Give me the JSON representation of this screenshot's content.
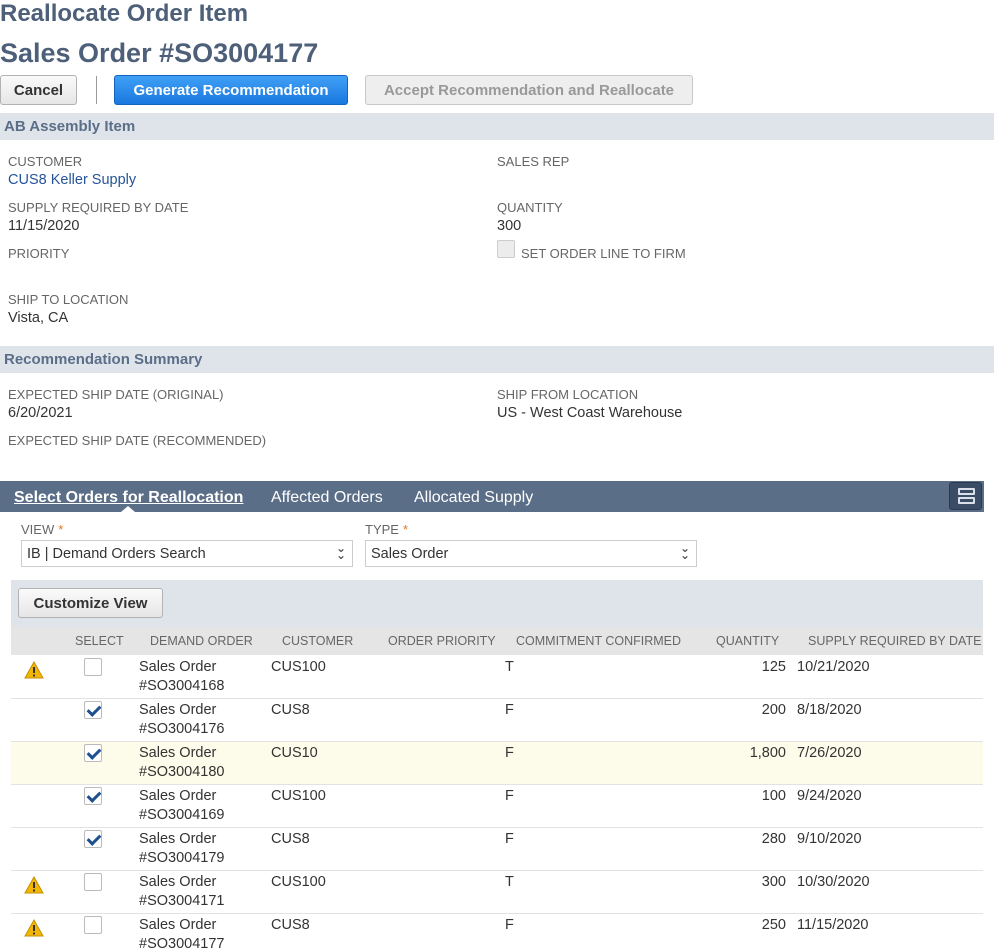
{
  "page": {
    "title": "Reallocate Order Item",
    "subtitle": "Sales Order #SO3004177"
  },
  "toolbar": {
    "cancel": "Cancel",
    "generate": "Generate Recommendation",
    "accept": "Accept Recommendation and Reallocate"
  },
  "item_section": {
    "header": "AB Assembly Item",
    "customer_label": "CUSTOMER",
    "customer_value": "CUS8 Keller Supply",
    "sales_rep_label": "SALES REP",
    "supply_date_label": "SUPPLY REQUIRED BY DATE",
    "supply_date_value": "11/15/2020",
    "quantity_label": "QUANTITY",
    "quantity_value": "300",
    "priority_label": "PRIORITY",
    "firm_label": "SET ORDER LINE TO FIRM",
    "ship_to_label": "SHIP TO LOCATION",
    "ship_to_value": "Vista, CA"
  },
  "recommendation": {
    "header": "Recommendation Summary",
    "exp_original_label": "EXPECTED SHIP DATE (ORIGINAL)",
    "exp_original_value": "6/20/2021",
    "ship_from_label": "SHIP FROM LOCATION",
    "ship_from_value": "US - West Coast Warehouse",
    "exp_recommended_label": "EXPECTED SHIP DATE (RECOMMENDED)"
  },
  "tabs": {
    "select_orders": "Select Orders for Reallocation",
    "affected_orders": "Affected Orders",
    "allocated_supply": "Allocated Supply"
  },
  "filters": {
    "view_label": "VIEW",
    "view_value": "IB | Demand Orders Search",
    "type_label": "TYPE",
    "type_value": "Sales Order",
    "required_mark": "*"
  },
  "grid": {
    "customize_view": "Customize View",
    "columns": [
      "SELECT",
      "DEMAND ORDER",
      "CUSTOMER",
      "ORDER PRIORITY",
      "COMMITMENT CONFIRMED",
      "QUANTITY",
      "SUPPLY REQUIRED BY DATE"
    ],
    "rows": [
      {
        "warn": true,
        "checked": false,
        "order1": "Sales Order",
        "order2": "#SO3004168",
        "customer": "CUS100",
        "priority": "",
        "confirmed": "T",
        "quantity": "125",
        "date": "10/21/2020",
        "highlight": false
      },
      {
        "warn": false,
        "checked": true,
        "order1": "Sales Order",
        "order2": "#SO3004176",
        "customer": "CUS8",
        "priority": "",
        "confirmed": "F",
        "quantity": "200",
        "date": "8/18/2020",
        "highlight": false
      },
      {
        "warn": false,
        "checked": true,
        "order1": "Sales Order",
        "order2": "#SO3004180",
        "customer": "CUS10",
        "priority": "",
        "confirmed": "F",
        "quantity": "1,800",
        "date": "7/26/2020",
        "highlight": true
      },
      {
        "warn": false,
        "checked": true,
        "order1": "Sales Order",
        "order2": "#SO3004169",
        "customer": "CUS100",
        "priority": "",
        "confirmed": "F",
        "quantity": "100",
        "date": "9/24/2020",
        "highlight": false
      },
      {
        "warn": false,
        "checked": true,
        "order1": "Sales Order",
        "order2": "#SO3004179",
        "customer": "CUS8",
        "priority": "",
        "confirmed": "F",
        "quantity": "280",
        "date": "9/10/2020",
        "highlight": false
      },
      {
        "warn": true,
        "checked": false,
        "order1": "Sales Order",
        "order2": "#SO3004171",
        "customer": "CUS100",
        "priority": "",
        "confirmed": "T",
        "quantity": "300",
        "date": "10/30/2020",
        "highlight": false
      },
      {
        "warn": true,
        "checked": false,
        "order1": "Sales Order",
        "order2": "#SO3004177",
        "customer": "CUS8",
        "priority": "",
        "confirmed": "F",
        "quantity": "250",
        "date": "11/15/2020",
        "highlight": false
      }
    ]
  },
  "colors": {
    "header_text": "#4d5f79",
    "section_bg": "#dfe4eb",
    "tabbar_bg": "#5b6e88",
    "link": "#255599",
    "primary_button": "#1a78e0",
    "warning": "#f2b705"
  }
}
